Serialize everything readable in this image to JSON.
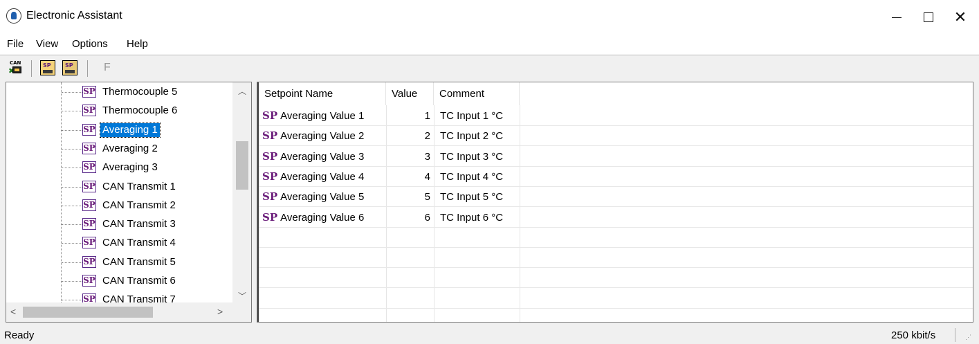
{
  "window": {
    "title": "Electronic Assistant"
  },
  "menu": {
    "items": [
      "File",
      "View",
      "Options",
      "Help"
    ]
  },
  "toolbar": {
    "can_icon_label": "CAN",
    "sp_label": "SP",
    "f_label": "F"
  },
  "tree": {
    "items": [
      {
        "icon": "SP",
        "label": "Thermocouple 5"
      },
      {
        "icon": "SP",
        "label": "Thermocouple 6"
      },
      {
        "icon": "SP",
        "label": "Averaging 1",
        "selected": true
      },
      {
        "icon": "SP",
        "label": "Averaging 2"
      },
      {
        "icon": "SP",
        "label": "Averaging 3"
      },
      {
        "icon": "SP",
        "label": "CAN Transmit 1"
      },
      {
        "icon": "SP",
        "label": "CAN Transmit 2"
      },
      {
        "icon": "SP",
        "label": "CAN Transmit 3"
      },
      {
        "icon": "SP",
        "label": "CAN Transmit 4"
      },
      {
        "icon": "SP",
        "label": "CAN Transmit 5"
      },
      {
        "icon": "SP",
        "label": "CAN Transmit 6"
      },
      {
        "icon": "SP",
        "label": "CAN Transmit 7"
      }
    ]
  },
  "list": {
    "columns": [
      "Setpoint Name",
      "Value",
      "Comment"
    ],
    "rows": [
      {
        "icon": "SP",
        "name": "Averaging Value 1",
        "value": "1",
        "comment": "TC Input 1 °C"
      },
      {
        "icon": "SP",
        "name": "Averaging Value 2",
        "value": "2",
        "comment": "TC Input 2 °C"
      },
      {
        "icon": "SP",
        "name": "Averaging Value 3",
        "value": "3",
        "comment": "TC Input 3 °C"
      },
      {
        "icon": "SP",
        "name": "Averaging Value 4",
        "value": "4",
        "comment": "TC Input 4 °C"
      },
      {
        "icon": "SP",
        "name": "Averaging Value 5",
        "value": "5",
        "comment": "TC Input 5 °C"
      },
      {
        "icon": "SP",
        "name": "Averaging Value 6",
        "value": "6",
        "comment": "TC Input 6 °C"
      }
    ]
  },
  "status": {
    "text": "Ready",
    "rate": "250 kbit/s"
  },
  "colors": {
    "selection": "#0078d7",
    "sp_icon": "#6a1c7a"
  }
}
